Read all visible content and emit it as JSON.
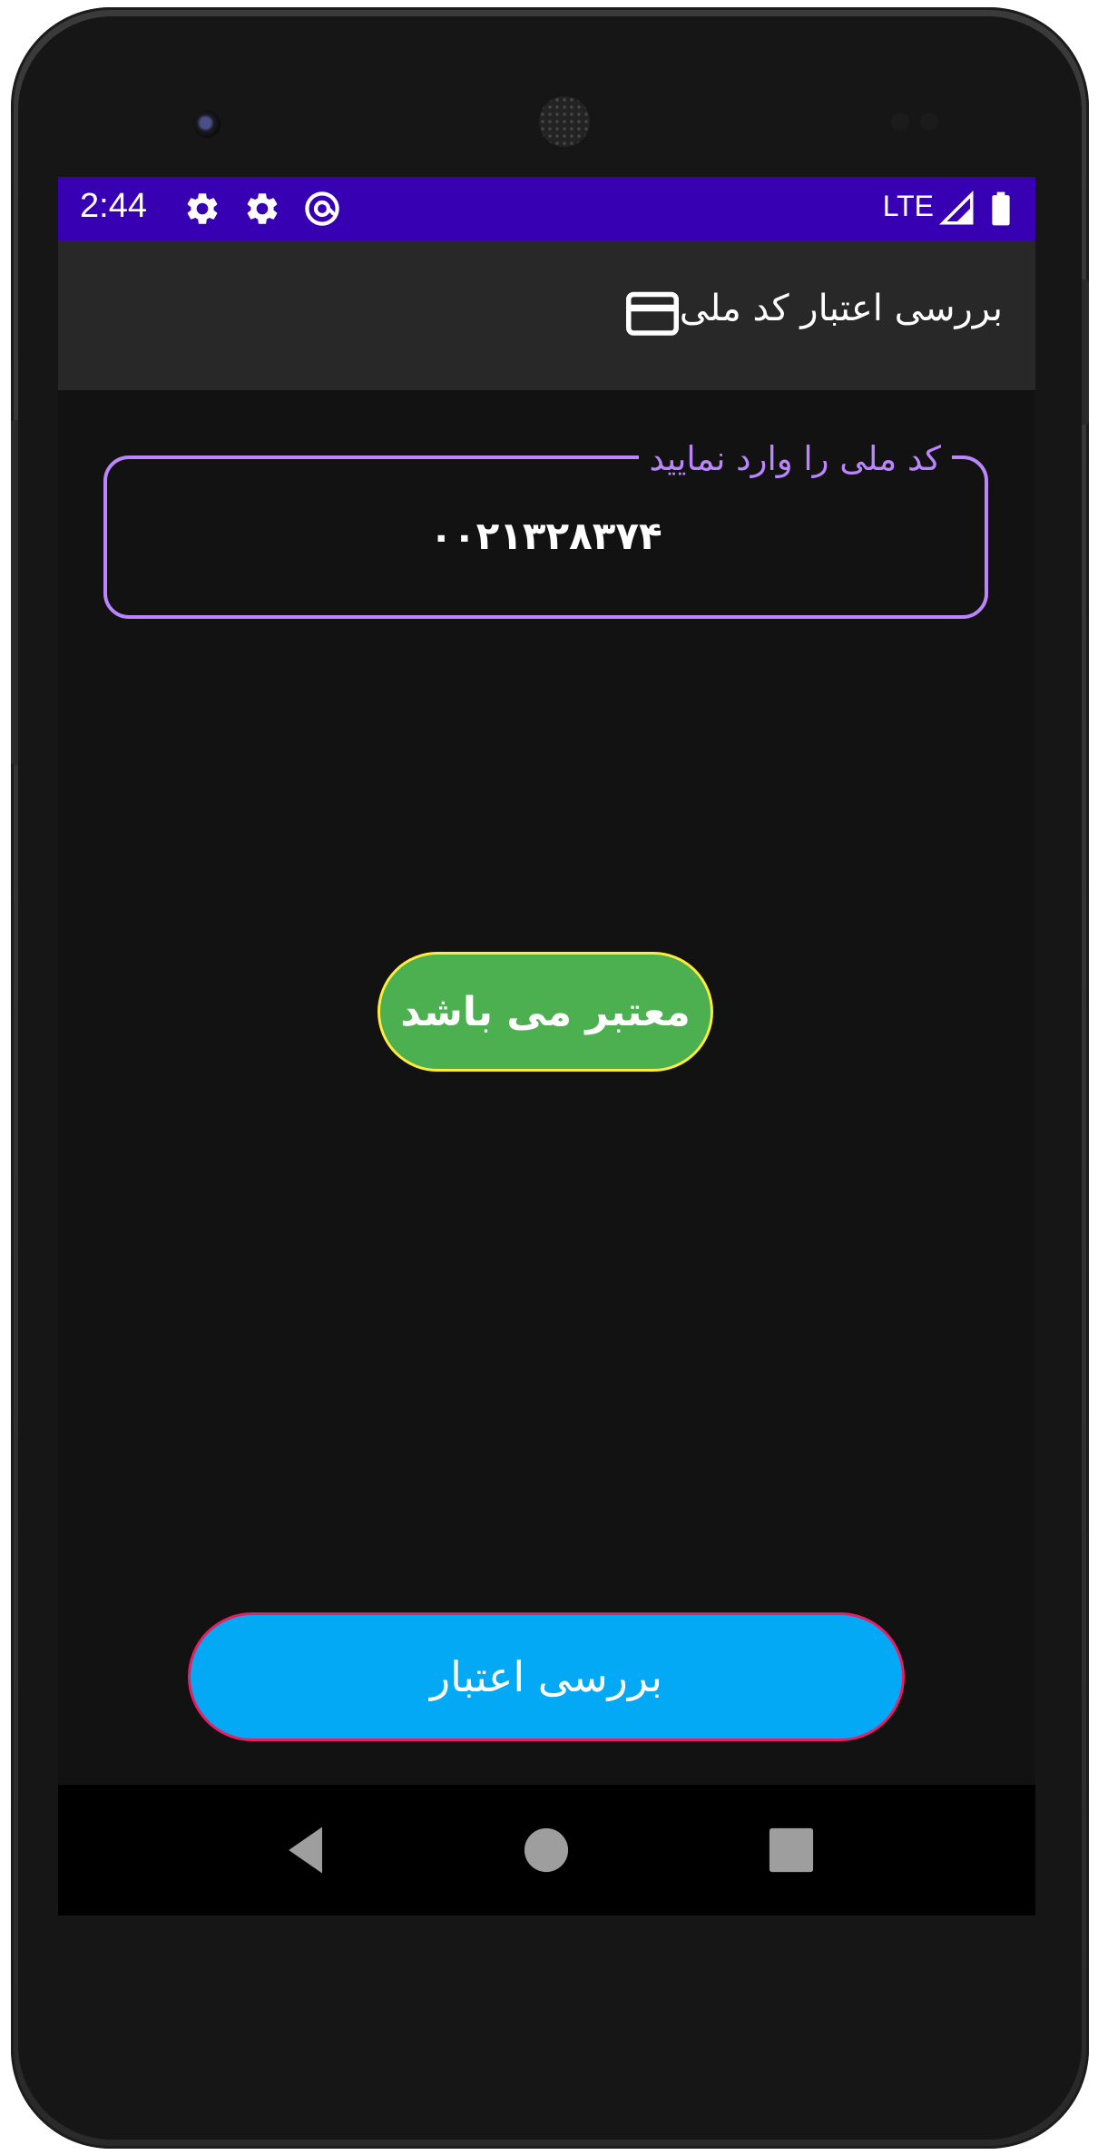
{
  "status_bar": {
    "time": "2:44",
    "network": "LTE",
    "icons": [
      "settings-icon",
      "settings-icon",
      "at-sign-notification-icon",
      "signal-icon",
      "battery-icon"
    ],
    "color": "#3700b3"
  },
  "app_bar": {
    "title": "بررسی اعتبار کد ملی",
    "icon": "credit-card-icon"
  },
  "input": {
    "label": "کد ملی را وارد نمایید",
    "value": "۰۰۲۱۳۲۸۳۷۴",
    "border_color": "#bb86fc"
  },
  "result": {
    "text": "معتبر می باشد",
    "background": "#4caf50",
    "border": "#ffeb3b"
  },
  "check_button": {
    "label": "بررسی اعتبار",
    "background": "#03a9f4",
    "border": "#e91e63"
  },
  "nav_bar": {
    "buttons": [
      "back-icon",
      "home-icon",
      "recents-icon"
    ]
  }
}
